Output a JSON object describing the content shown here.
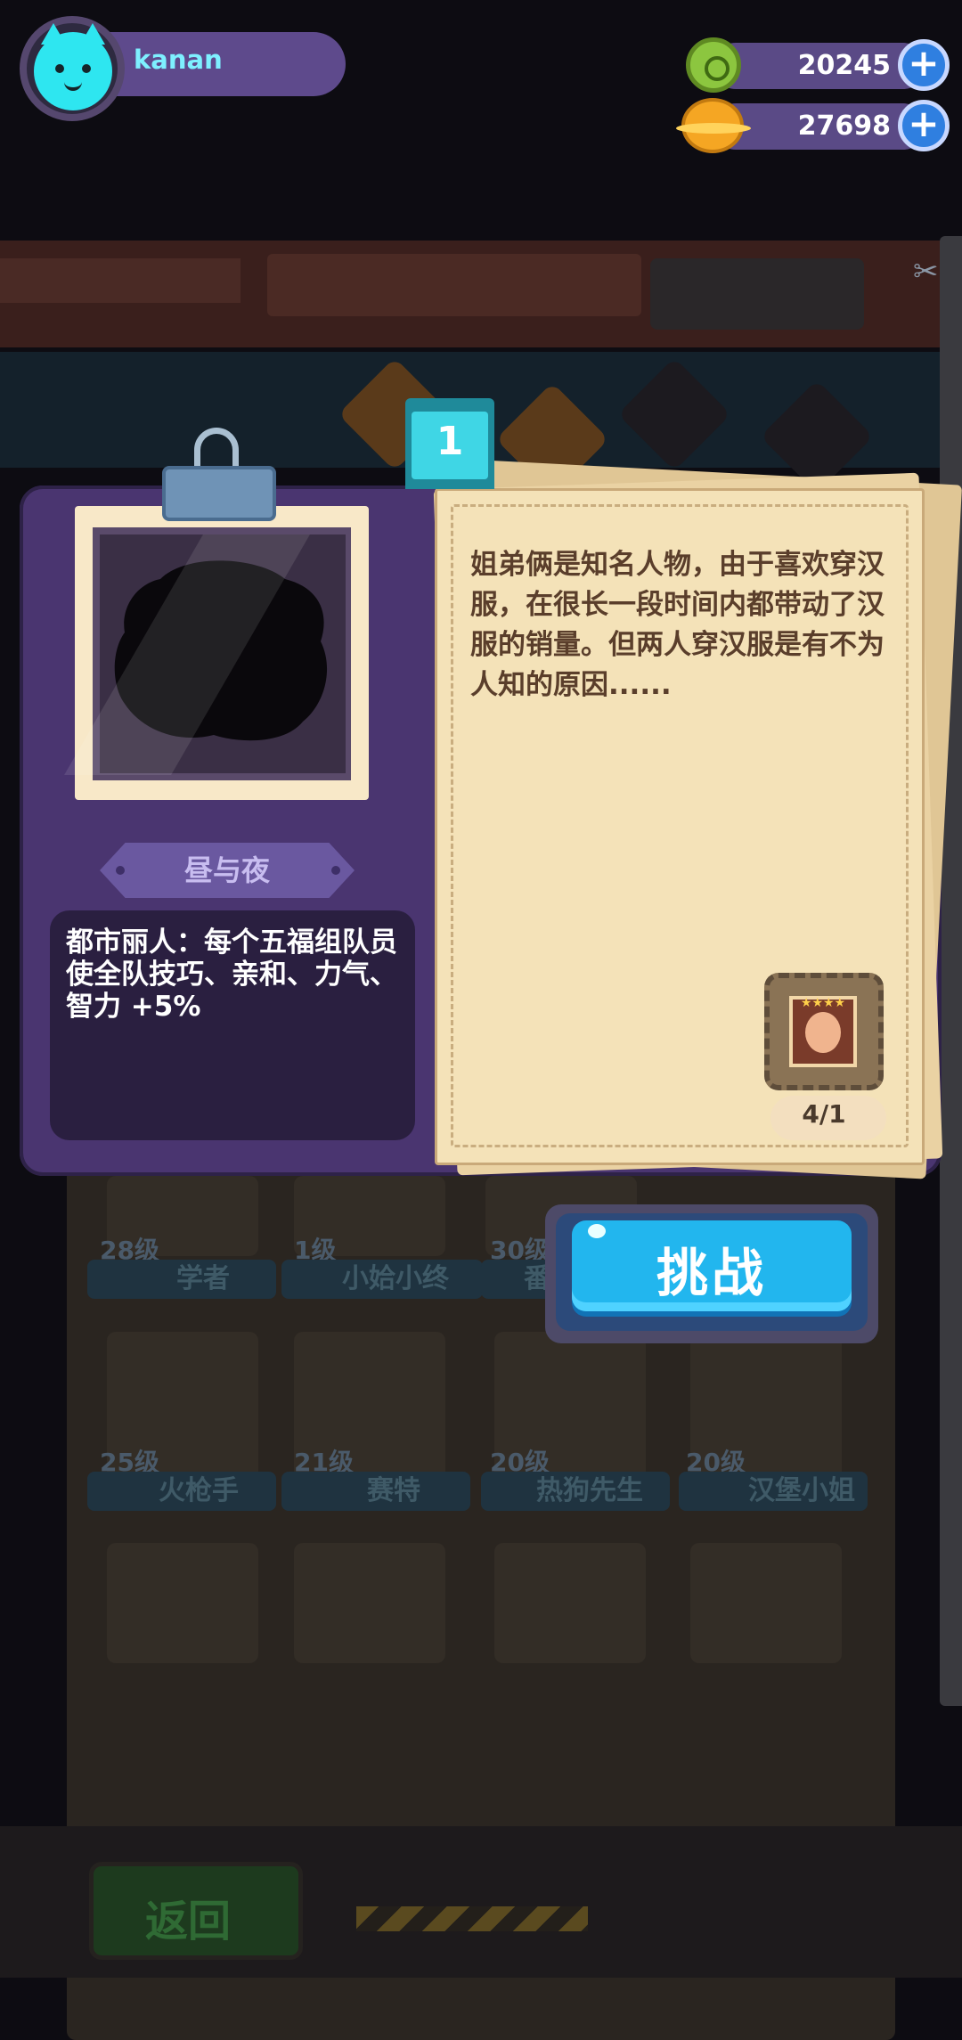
{
  "player": {
    "username": "kanan",
    "avatar": "cyan-cat-avatar-icon"
  },
  "currencies": [
    {
      "icon": "green-coin-icon",
      "value": "20245",
      "color": "#8cc63f"
    },
    {
      "icon": "gold-planet-coin-icon",
      "value": "27698",
      "color": "#f5a623"
    }
  ],
  "card": {
    "index": "1",
    "name": "昼与夜",
    "effect": "都市丽人：每个五福组队员使全队技巧、亲和、力气、智力 +5%",
    "story": "姐弟俩是知名人物，由于喜欢穿汉服，在很长一段时间内都带动了汉服的销量。但两人穿汉服是有不为人知的原因......",
    "reward_progress": "4/1",
    "reward_stars": "★★★★"
  },
  "actions": {
    "challenge": "挑战",
    "back": "返回"
  },
  "background_roster": [
    {
      "level": "28级",
      "name": "学者"
    },
    {
      "level": "1级",
      "name": "小姶小终"
    },
    {
      "level": "30级",
      "name": "番"
    },
    {
      "level": "25级",
      "name": "火枪手"
    },
    {
      "level": "21级",
      "name": "赛特"
    },
    {
      "level": "20级",
      "name": "热狗先生"
    },
    {
      "level": "20级",
      "name": "汉堡小姐"
    }
  ],
  "colors": {
    "panel": "#4a3570",
    "paper": "#f4e2b8",
    "accent_cyan": "#22b6ee",
    "username": "#7ef0ff"
  }
}
